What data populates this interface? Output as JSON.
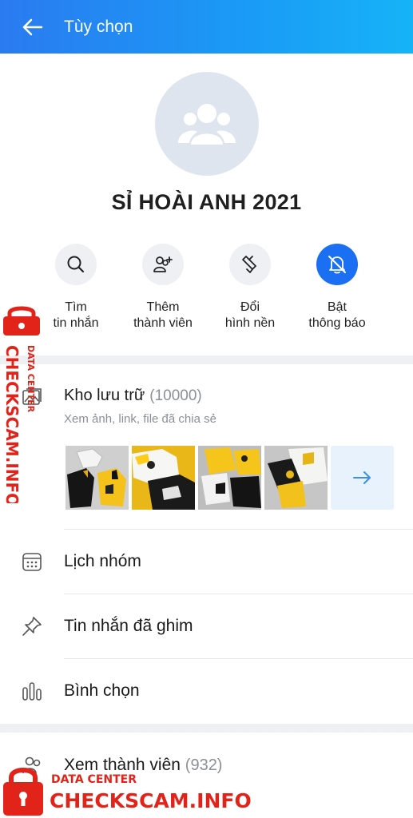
{
  "header": {
    "title": "Tùy chọn"
  },
  "group": {
    "name": "SỈ HOÀI ANH 2021"
  },
  "actions": [
    {
      "label": "Tìm\ntin nhắn",
      "icon": "search-icon"
    },
    {
      "label": "Thêm\nthành viên",
      "icon": "add-member-icon"
    },
    {
      "label": "Đổi\nhình nền",
      "icon": "paint-brush-icon"
    },
    {
      "label": "Bật\nthông báo",
      "icon": "bell-off-icon"
    }
  ],
  "storage": {
    "title": "Kho lưu trữ",
    "count": "(10000)",
    "subtitle": "Xem ảnh, link, file đã chia sẻ",
    "icon": "gallery-icon"
  },
  "menu": [
    {
      "label": "Lịch nhóm",
      "icon": "calendar-icon"
    },
    {
      "label": "Tin nhắn đã ghim",
      "icon": "pin-icon"
    },
    {
      "label": "Bình chọn",
      "icon": "poll-icon"
    }
  ],
  "members": {
    "label": "Xem thành viên",
    "count": "(932)",
    "icon": "members-icon"
  },
  "watermark": {
    "line1": "DATA CENTER",
    "line2": "CHECKSCAM.INFO"
  },
  "colors": {
    "accent": "#1a6ff2",
    "header_gradient_start": "#2a7bf0",
    "header_gradient_end": "#16b3f7",
    "watermark": "#e2231a"
  }
}
